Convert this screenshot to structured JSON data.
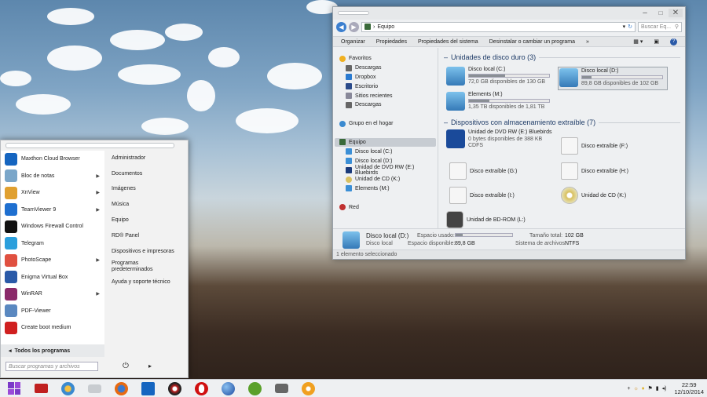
{
  "explorer": {
    "address": "Equipo",
    "search_placeholder": "Buscar Eq...",
    "toolbar": [
      "Organizar",
      "Propiedades",
      "Propiedades del sistema",
      "Desinstalar o cambiar un programa",
      "»"
    ],
    "nav": {
      "favorites": "Favoritos",
      "fav_items": [
        "Descargas",
        "Dropbox",
        "Escritorio",
        "Sitios recientes",
        "Descargas"
      ],
      "homegroup": "Grupo en el hogar",
      "computer": "Equipo",
      "computer_items": [
        "Disco local (C:)",
        "Disco local (D:)",
        "Unidad de DVD RW (E:) Bluebirds",
        "Unidad de CD (K:)",
        "Elements (M:)"
      ],
      "network": "Red"
    },
    "hdd_header": "Unidades de disco duro (3)",
    "drives": [
      {
        "name": "Disco local (C:)",
        "free": "72,0 GB disponibles de 130 GB",
        "used": 0.45
      },
      {
        "name": "Disco local (D:)",
        "free": "89,8 GB disponibles de 102 GB",
        "used": 0.12
      },
      {
        "name": "Elements (M:)",
        "free": "1,35 TB disponibles de 1,81 TB",
        "used": 0.25
      }
    ],
    "removable_header": "Dispositivos con almacenamiento extraíble (7)",
    "removable": {
      "dvd_name": "Unidad de DVD RW (E:) Bluebirds",
      "dvd_free": "0 bytes disponibles de 388 KB",
      "dvd_fs": "CDFS",
      "f": "Disco extraíble (F:)",
      "g": "Disco extraíble (G:)",
      "h": "Disco extraíble (H:)",
      "i": "Disco extraíble (I:)",
      "k": "Unidad de CD (K:)",
      "l": "Unidad de BD-ROM (L:)"
    },
    "details": {
      "name": "Disco local (D:)",
      "type": "Disco local",
      "used_label": "Espacio usado:",
      "free_label": "Espacio disponible:",
      "free_value": "89,8 GB",
      "total_label": "Tamaño total:",
      "total_value": "102 GB",
      "fs_label": "Sistema de archivos:",
      "fs_value": "NTFS",
      "used": 0.12
    },
    "status": "1 elemento seleccionado"
  },
  "start_menu": {
    "programs": [
      {
        "label": "Maxthon Cloud Browser",
        "color": "#1565c0",
        "arrow": false
      },
      {
        "label": "Bloc de notas",
        "color": "#7aa6c9",
        "arrow": true
      },
      {
        "label": "XnView",
        "color": "#e0a030",
        "arrow": true
      },
      {
        "label": "TeamViewer 9",
        "color": "#1e6fd0",
        "arrow": true
      },
      {
        "label": "Windows Firewall Control",
        "color": "#111111",
        "arrow": false
      },
      {
        "label": "Telegram",
        "color": "#2b9fdc",
        "arrow": false
      },
      {
        "label": "PhotoScape",
        "color": "#e05040",
        "arrow": true
      },
      {
        "label": "Enigma Virtual Box",
        "color": "#2a5aa8",
        "arrow": false
      },
      {
        "label": "WinRAR",
        "color": "#8b2a6a",
        "arrow": true
      },
      {
        "label": "PDF-Viewer",
        "color": "#5a88c0",
        "arrow": false
      },
      {
        "label": "Create boot medium",
        "color": "#d02020",
        "arrow": false
      }
    ],
    "right_items": [
      "Administrador",
      "Documentos",
      "Imágenes",
      "Música",
      "Equipo",
      "RD® Panel",
      "Dispositivos e impresoras",
      "Programas predeterminados",
      "Ayuda y soporte técnico"
    ],
    "all_programs": "Todos los programas",
    "search_placeholder": "Buscar programas y archivos"
  },
  "taskbar": {
    "time": "22:59",
    "date": "12/10/2014",
    "icons": [
      "windows-start-icon",
      "media-folder-icon",
      "system-settings-icon",
      "drive-icon",
      "firefox-icon",
      "maxthon-icon",
      "media-player-icon",
      "opera-icon",
      "globe-icon",
      "utorrent-icon",
      "camera-icon",
      "xnview-icon"
    ]
  }
}
